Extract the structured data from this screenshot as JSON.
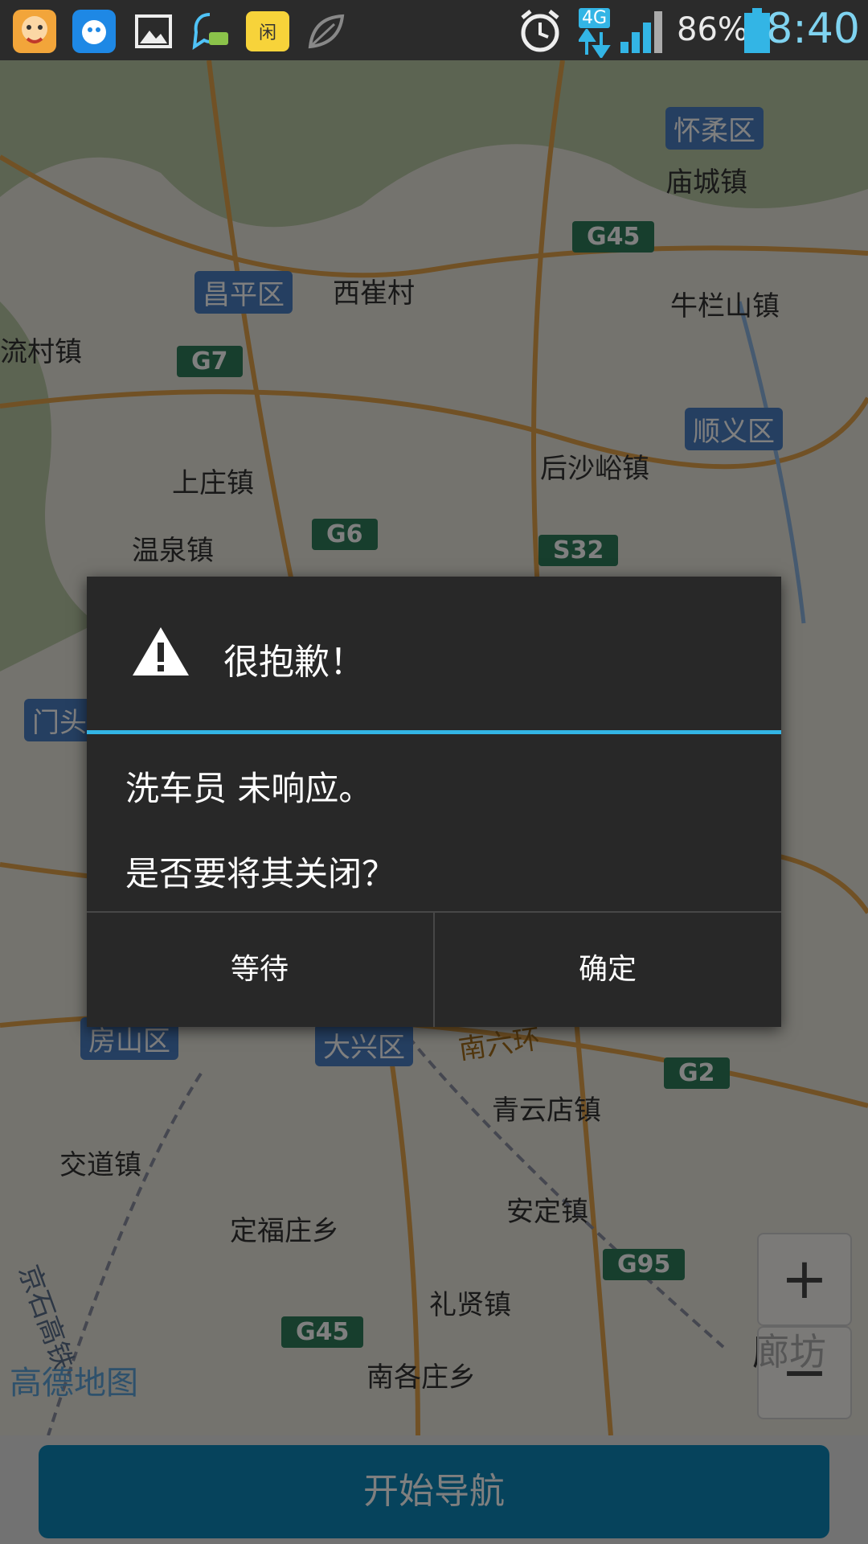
{
  "status_bar": {
    "app_icons": [
      "game-app-icon",
      "assistant-app-icon",
      "gallery-icon",
      "chat-app-icon",
      "yellow-app-icon",
      "leaf-icon"
    ],
    "network": "4G",
    "battery": "86%",
    "time": "8:40"
  },
  "map": {
    "places": [
      "怀柔区",
      "庙城镇",
      "G45",
      "昌平区",
      "西崔村",
      "牛栏山镇",
      "流村镇",
      "G7",
      "顺义区",
      "后沙峪镇",
      "上庄镇",
      "G6",
      "S32",
      "温泉镇",
      "门头",
      "房山区",
      "大兴区",
      "南六环",
      "G2",
      "青云店镇",
      "交道镇",
      "安定镇",
      "定福庄乡",
      "G95",
      "礼贤镇",
      "G45",
      "廊坊",
      "南各庄乡",
      "京石高铁"
    ],
    "logo": "高德地图",
    "zoom_in": "+",
    "zoom_out": "−"
  },
  "dialog": {
    "title": "很抱歉！",
    "message_line1": "洗车员 未响应。",
    "message_line2": "是否要将其关闭？",
    "wait_button": "等待",
    "ok_button": "确定",
    "accent_color": "#33b5e5"
  },
  "bottom": {
    "nav_button": "开始导航"
  }
}
